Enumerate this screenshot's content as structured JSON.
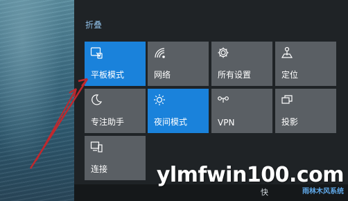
{
  "action_center": {
    "collapse_label": "折叠",
    "tiles": [
      {
        "label": "平板模式",
        "icon": "tablet-mode-icon",
        "active": true
      },
      {
        "label": "网络",
        "icon": "network-icon",
        "active": false
      },
      {
        "label": "所有设置",
        "icon": "settings-gear-icon",
        "active": false
      },
      {
        "label": "定位",
        "icon": "location-icon",
        "active": false
      },
      {
        "label": "专注助手",
        "icon": "moon-icon",
        "active": false
      },
      {
        "label": "夜间模式",
        "icon": "night-light-sun-icon",
        "active": true
      },
      {
        "label": "VPN",
        "icon": "vpn-icon",
        "active": false
      },
      {
        "label": "投影",
        "icon": "project-icon",
        "active": false
      },
      {
        "label": "连接",
        "icon": "connect-icon",
        "active": false
      }
    ]
  },
  "taskbar": {
    "partial_text": "快"
  },
  "watermark": {
    "main": "ylmfwin100.com",
    "sub": "雨林木风系统"
  },
  "colors": {
    "active_tile": "#1a82db",
    "inactive_tile": "#5a5f64",
    "panel": "#1f2326",
    "arrow": "#c0282d"
  }
}
